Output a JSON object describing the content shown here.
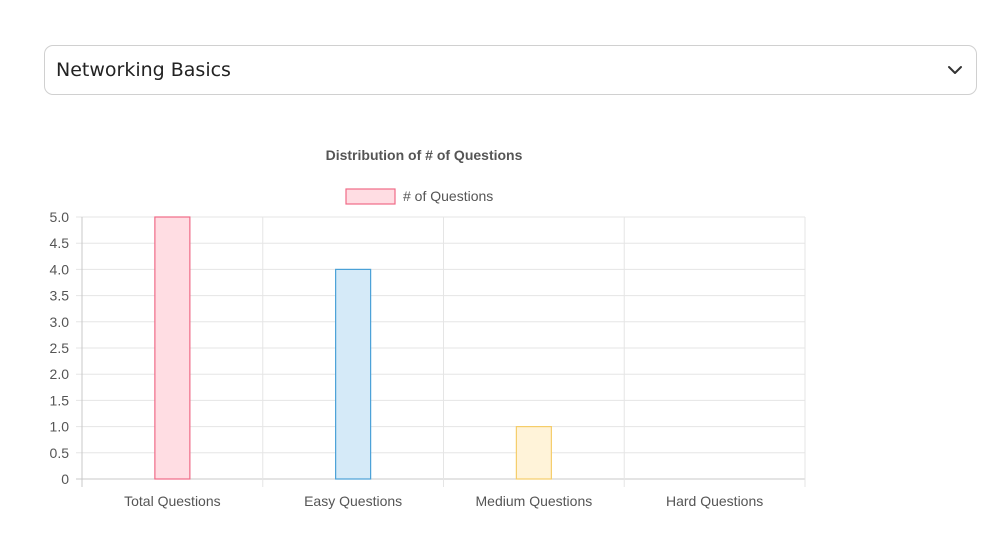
{
  "selector": {
    "value": "Networking Basics",
    "icon": "chevron-down-icon"
  },
  "chart_data": {
    "type": "bar",
    "title": "Distribution of # of Questions",
    "categories": [
      "Total Questions",
      "Easy Questions",
      "Medium Questions",
      "Hard Questions"
    ],
    "series": [
      {
        "name": "# of Questions",
        "values": [
          5,
          4,
          1,
          0
        ]
      }
    ],
    "bar_colors": [
      {
        "fill": "#ffdde3",
        "stroke": "#ef6b87"
      },
      {
        "fill": "#d5eaf8",
        "stroke": "#4aa1d7"
      },
      {
        "fill": "#fff3d9",
        "stroke": "#f5cd6a"
      },
      {
        "fill": "#e2f5f5",
        "stroke": "#55bfbf"
      }
    ],
    "legend_color": {
      "fill": "#ffdde3",
      "stroke": "#ef6b87"
    },
    "ylim": [
      0,
      5
    ],
    "y_ticks": [
      "0",
      "0.5",
      "1.0",
      "1.5",
      "2.0",
      "2.5",
      "3.0",
      "3.5",
      "4.0",
      "4.5",
      "5.0"
    ],
    "y_tick_values": [
      0,
      0.5,
      1,
      1.5,
      2,
      2.5,
      3,
      3.5,
      4,
      4.5,
      5
    ],
    "grid": true,
    "legend_position": "top"
  }
}
